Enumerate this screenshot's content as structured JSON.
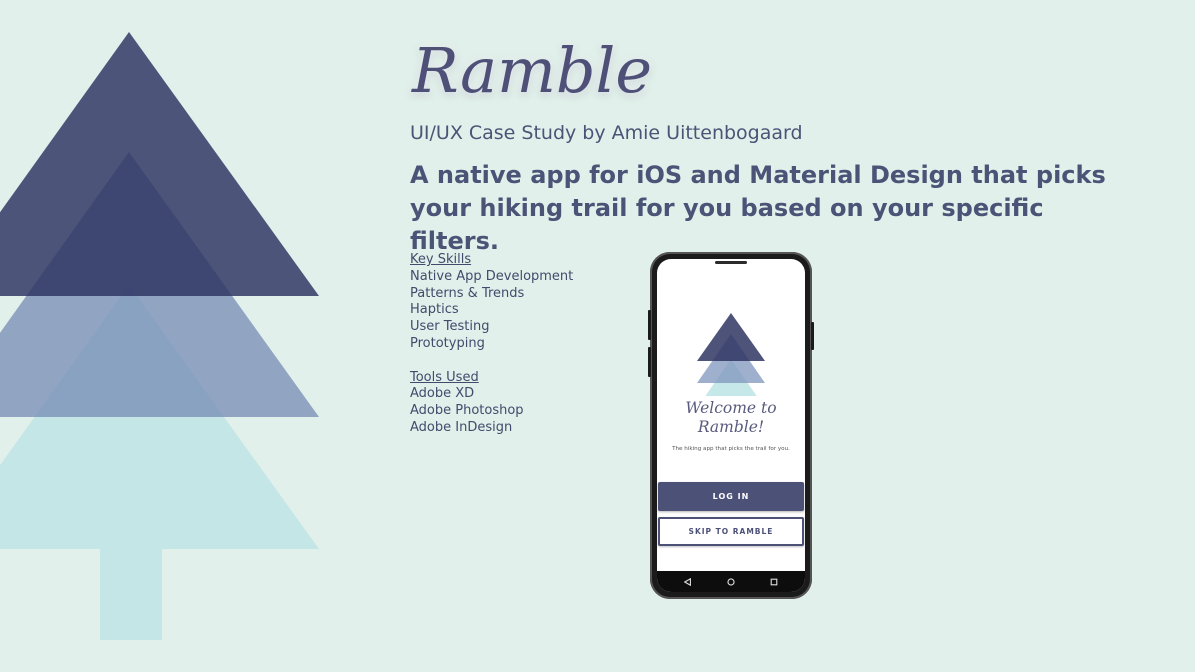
{
  "hero": {
    "title": "Ramble",
    "subtitle": "UI/UX Case Study by Amie Uittenbogaard",
    "tagline": "A native app for iOS and Material Design that picks your hiking trail for you based on your specific filters."
  },
  "key_skills": {
    "heading": "Key Skills",
    "items": [
      "Native App Development",
      "Patterns & Trends",
      "Haptics",
      "User Testing",
      "Prototyping"
    ]
  },
  "tools": {
    "heading": "Tools Used",
    "items": [
      "Adobe XD",
      "Adobe Photoshop",
      "Adobe InDesign"
    ]
  },
  "phone": {
    "welcome_line1": "Welcome to",
    "welcome_line2": "Ramble!",
    "subtitle": "The hiking app that picks the trail for you.",
    "login_label": "LOG IN",
    "skip_label": "SKIP TO RAMBLE",
    "nav_icons": [
      "back-icon",
      "home-icon",
      "recents-icon"
    ]
  },
  "colors": {
    "background": "#e1f0ea",
    "tree_dark": "#4b4f73",
    "tree_mid": "#8f9fc3",
    "tree_light": "#c5e6e6",
    "button": "#4c5178"
  }
}
